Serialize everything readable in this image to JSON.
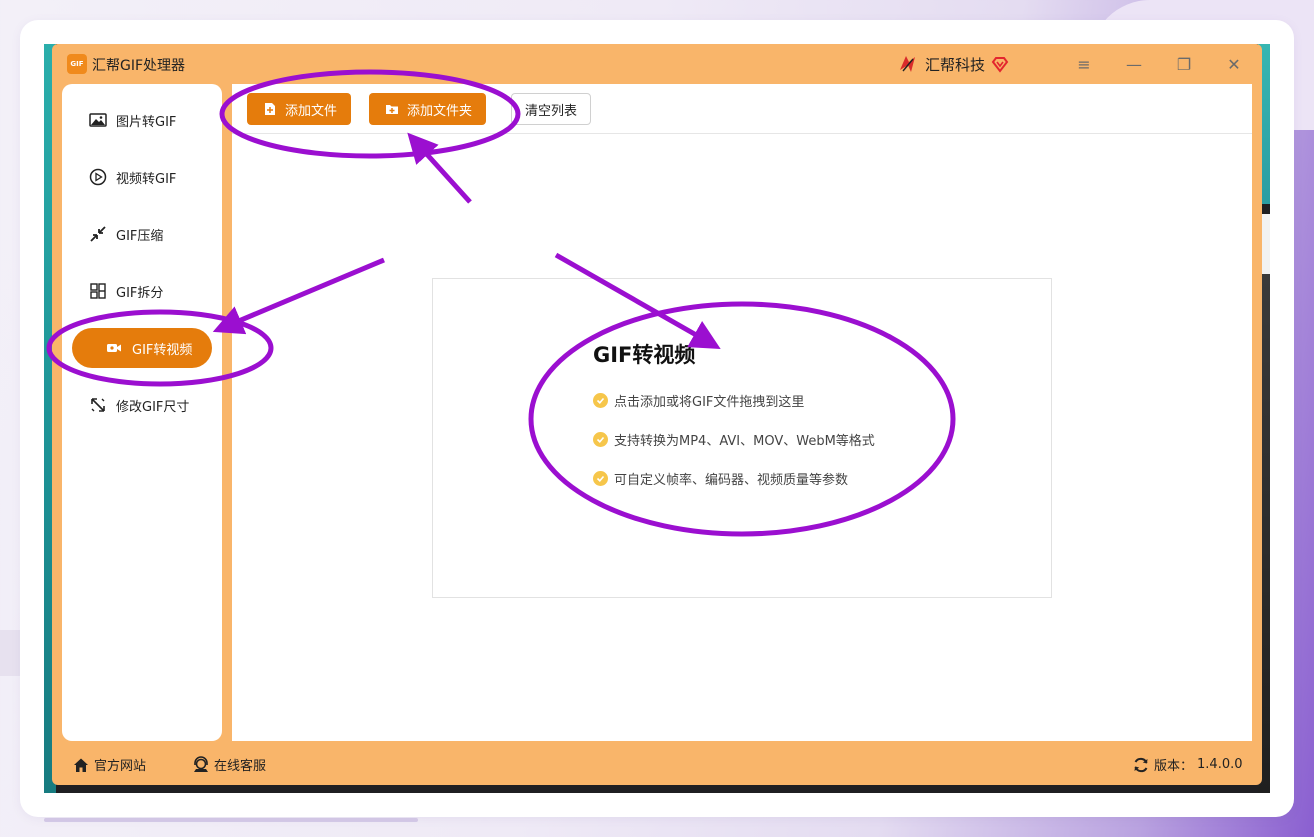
{
  "app": {
    "title": "汇帮GIF处理器",
    "logo_text": "GIF",
    "brand_name": "汇帮科技",
    "accent_color": "#e57c0c",
    "frame_color": "#f9b56a"
  },
  "window_controls": {
    "menu_icon": "≡",
    "minimize_icon": "—",
    "maximize_icon": "❐",
    "close_icon": "✕"
  },
  "sidebar": {
    "items": [
      {
        "label": "图片转GIF",
        "icon": "image-icon"
      },
      {
        "label": "视频转GIF",
        "icon": "play-circle-icon"
      },
      {
        "label": "GIF压缩",
        "icon": "compress-icon"
      },
      {
        "label": "GIF拆分",
        "icon": "split-icon"
      },
      {
        "label": "GIF转视频",
        "icon": "video-camera-icon",
        "active": true
      },
      {
        "label": "修改GIF尺寸",
        "icon": "resize-icon"
      }
    ]
  },
  "toolbar": {
    "add_file": "添加文件",
    "add_folder": "添加文件夹",
    "clear_list": "清空列表"
  },
  "dropzone": {
    "title": "GIF转视频",
    "features": [
      "点击添加或将GIF文件拖拽到这里",
      "支持转换为MP4、AVI、MOV、WebM等格式",
      "可自定义帧率、编码器、视频质量等参数"
    ]
  },
  "footer": {
    "website": "官方网站",
    "support": "在线客服",
    "version_label": "版本：",
    "version": "1.4.0.0"
  },
  "annotation_color": "#9b0fd0"
}
